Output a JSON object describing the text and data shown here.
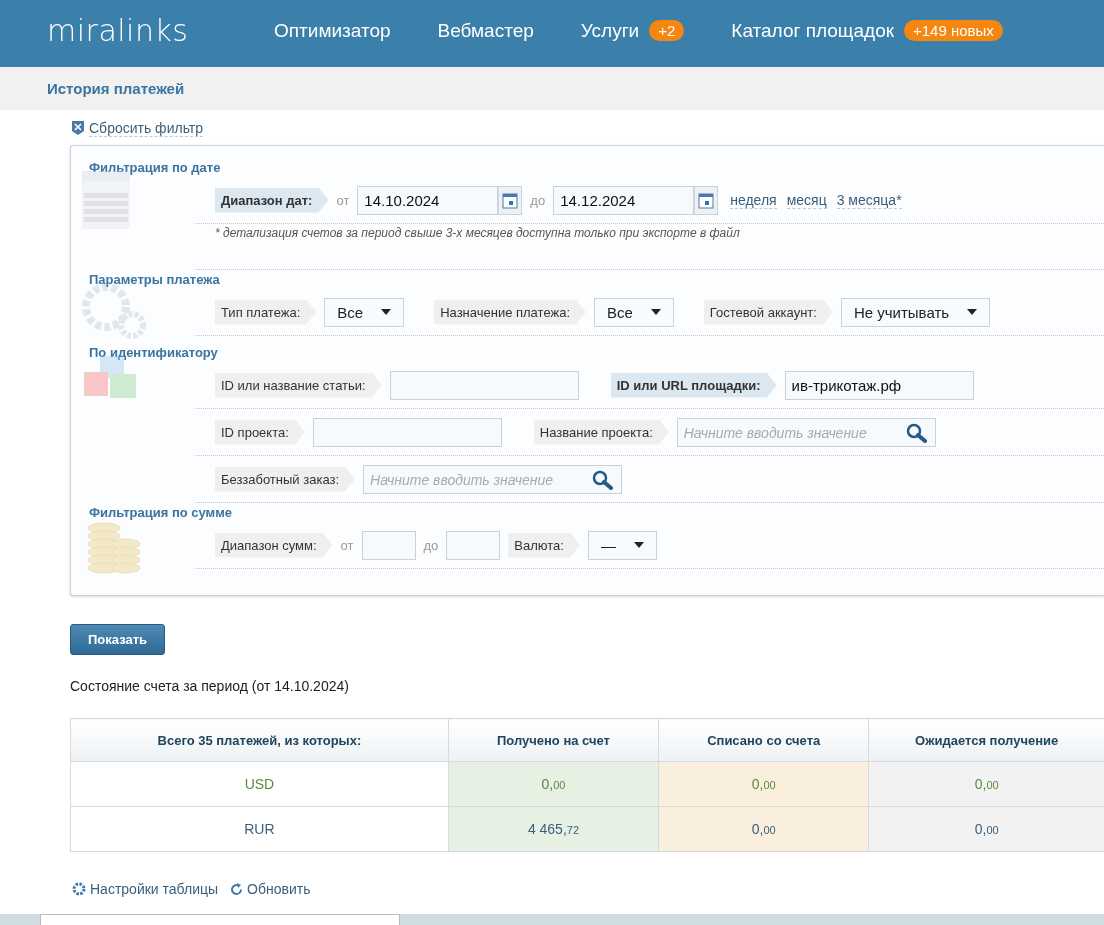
{
  "header": {
    "logo": "miralinks",
    "nav": [
      {
        "label": "Оптимизатор"
      },
      {
        "label": "Вебмастер"
      },
      {
        "label": "Услуги",
        "badge": "+2"
      },
      {
        "label": "Каталог площадок",
        "badge": "+149 новых"
      }
    ]
  },
  "page_title": "История платежей",
  "reset_filter": "Сбросить фильтр",
  "filter_sections": [
    {
      "title": "Фильтрация по дате",
      "rows": [
        [
          {
            "kind": "label",
            "text": "Диапазон дат:",
            "active": true
          },
          {
            "kind": "text",
            "text": "от"
          },
          {
            "kind": "date",
            "value": "14.10.2024"
          },
          {
            "kind": "text",
            "text": "до"
          },
          {
            "kind": "date",
            "value": "14.12.2024"
          },
          {
            "kind": "link",
            "text": "неделя"
          },
          {
            "kind": "link",
            "text": "месяц"
          },
          {
            "kind": "link",
            "text": "3 месяца*"
          }
        ],
        [
          {
            "kind": "note",
            "text": "* детализация счетов за период свыше 3-х месяцев доступна только при экспорте в файл"
          }
        ]
      ]
    },
    {
      "title": "Параметры платежа",
      "rows": [
        [
          {
            "kind": "label",
            "text": "Тип платежа:",
            "active": false
          },
          {
            "kind": "select",
            "value": "Все"
          },
          {
            "kind": "label",
            "text": "Назначение платежа:",
            "active": false
          },
          {
            "kind": "select",
            "value": "Все"
          },
          {
            "kind": "label",
            "text": "Гостевой аккаунт:",
            "active": false
          },
          {
            "kind": "select",
            "value": "Не учитывать"
          }
        ]
      ]
    },
    {
      "title": "По идентификатору",
      "rows": [
        [
          {
            "kind": "label",
            "text": "ID или название статьи:",
            "active": false
          },
          {
            "kind": "input"
          },
          {
            "kind": "label",
            "text": "ID или URL площадки:",
            "active": true
          },
          {
            "kind": "input",
            "value": "ив-трикотаж.рф"
          }
        ],
        [
          {
            "kind": "label",
            "text": "ID проекта:",
            "active": false
          },
          {
            "kind": "input"
          },
          {
            "kind": "label",
            "text": "Название проекта:",
            "active": false
          },
          {
            "kind": "search",
            "placeholder": "Начните вводить значение"
          }
        ],
        [
          {
            "kind": "label",
            "text": "Беззаботный заказ:",
            "active": false
          },
          {
            "kind": "search",
            "placeholder": "Начните вводить значение"
          }
        ]
      ]
    },
    {
      "title": "Фильтрация по сумме",
      "rows": [
        [
          {
            "kind": "label",
            "text": "Диапазон сумм:",
            "active": false
          },
          {
            "kind": "text",
            "text": "от"
          },
          {
            "kind": "amount"
          },
          {
            "kind": "text",
            "text": "до"
          },
          {
            "kind": "amount"
          },
          {
            "kind": "label",
            "text": "Валюта:",
            "active": false
          },
          {
            "kind": "select",
            "value": "—"
          }
        ]
      ]
    }
  ],
  "show_button": "Показать",
  "period_caption": "Состояние счета за период (от 14.10.2024)",
  "summary_table": {
    "columns": [
      "Всего 35 платежей, из которых:",
      "Получено на счет",
      "Списано со счета",
      "Ожидается получение"
    ],
    "rows": [
      {
        "color": "#5b8a3c",
        "cells": [
          {
            "text": "USD"
          },
          {
            "whole": "0,",
            "cents": "00"
          },
          {
            "whole": "0,",
            "cents": "00"
          },
          {
            "whole": "0,",
            "cents": "00"
          }
        ]
      },
      {
        "color": "#3a5f7d",
        "cells": [
          {
            "text": "RUR"
          },
          {
            "whole": "4 465,",
            "cents": "72"
          },
          {
            "whole": "0,",
            "cents": "00"
          },
          {
            "whole": "0,",
            "cents": "00"
          }
        ]
      }
    ]
  },
  "footer_links": [
    "Настройки таблицы",
    "Обновить"
  ]
}
